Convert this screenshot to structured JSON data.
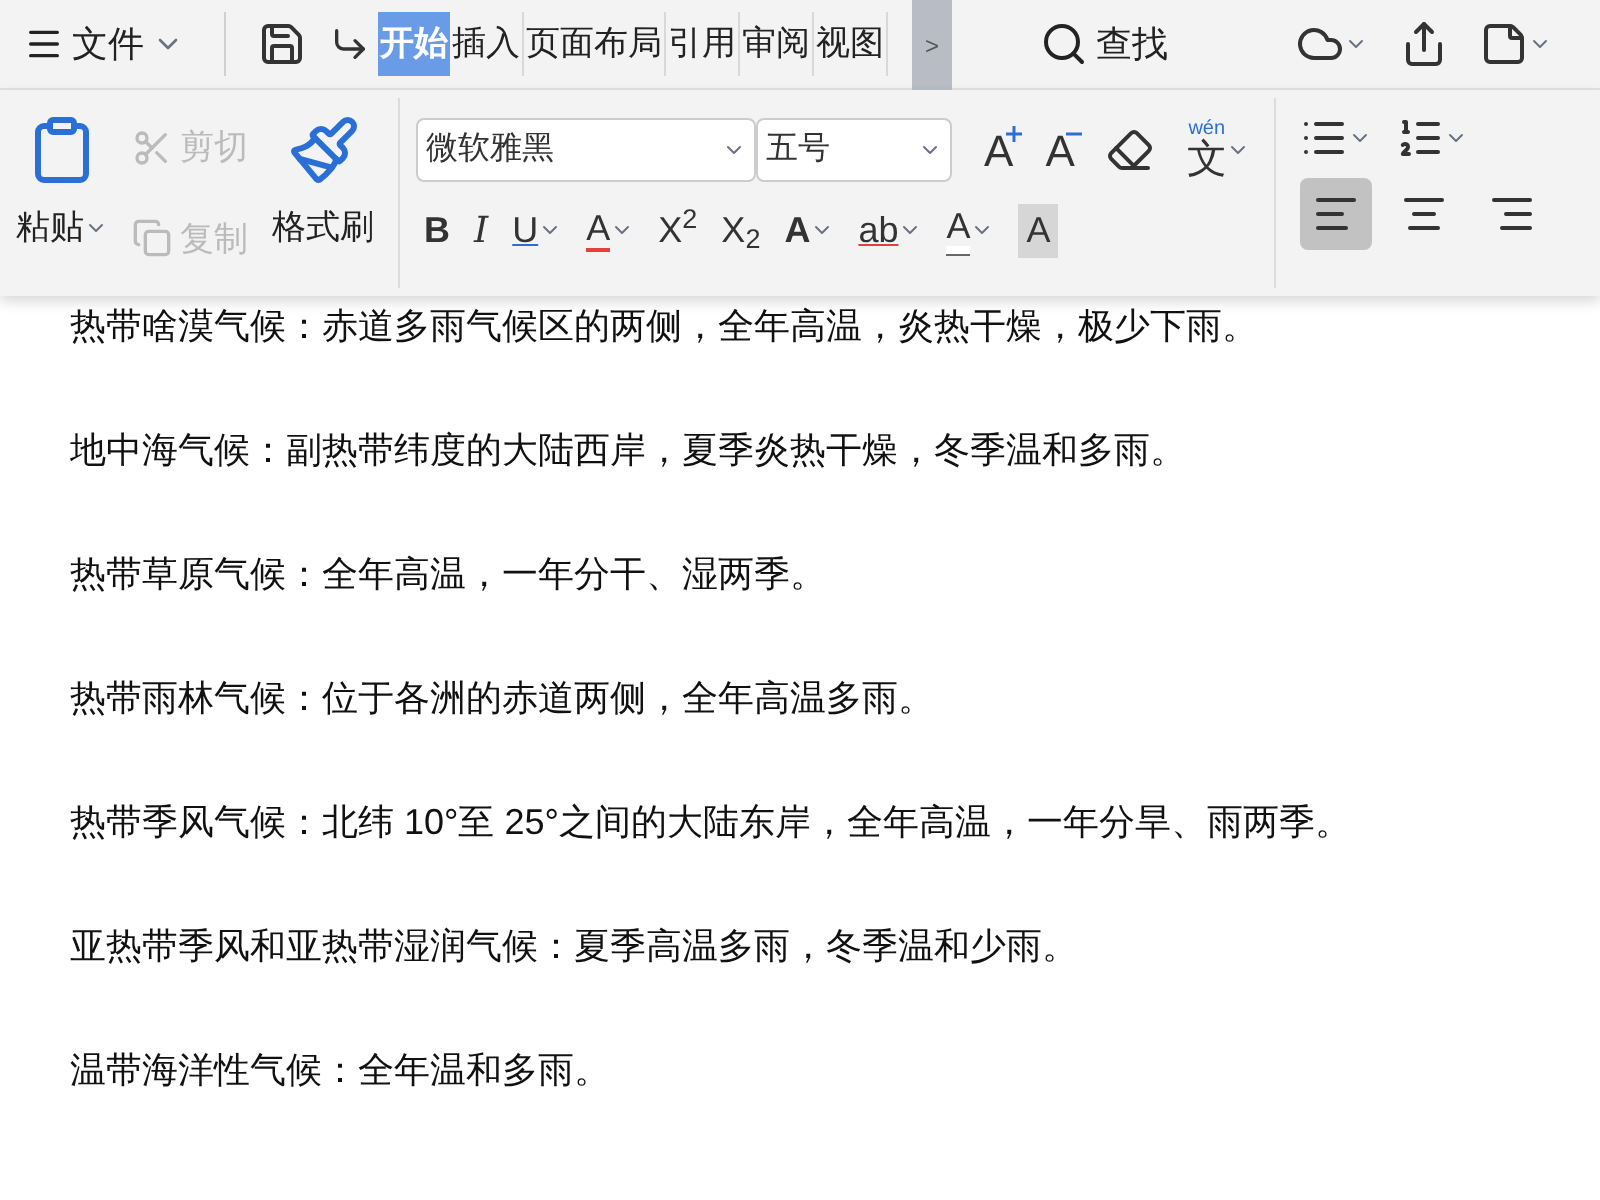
{
  "menu": {
    "label": "文件"
  },
  "tabs": [
    {
      "label": "开始",
      "selected": true
    },
    {
      "label": "插入",
      "selected": false
    },
    {
      "label": "页面布局",
      "selected": false
    },
    {
      "label": "引用",
      "selected": false
    },
    {
      "label": "审阅",
      "selected": false
    },
    {
      "label": "视图",
      "selected": false
    }
  ],
  "tab_scroll": ">",
  "search": {
    "label": "查找"
  },
  "clipboard": {
    "paste": "粘贴",
    "cut": {
      "label": "剪切",
      "disabled": true
    },
    "copy": {
      "label": "复制",
      "disabled": true
    },
    "format_painter": "格式刷"
  },
  "font": {
    "family": "微软雅黑",
    "size": "五号"
  },
  "font_row": [
    {
      "kind": "grow",
      "text": "A"
    },
    {
      "kind": "shrink",
      "text": "A"
    },
    {
      "kind": "eraser"
    },
    {
      "kind": "pinyin",
      "text": "文",
      "ruby": "wén",
      "dropdown": true
    }
  ],
  "format_row": [
    {
      "kind": "bold",
      "text": "B",
      "dropdown": false
    },
    {
      "kind": "italic",
      "text": "I",
      "dropdown": false
    },
    {
      "kind": "underline",
      "text": "U",
      "dropdown": true
    },
    {
      "kind": "strike",
      "text": "A",
      "dropdown": true
    },
    {
      "kind": "plain",
      "text": "X$^{2}$",
      "dropdown": false
    },
    {
      "kind": "plain",
      "text": "X$_{2}$",
      "dropdown": false
    },
    {
      "kind": "outline",
      "text": "A",
      "dropdown": true
    },
    {
      "kind": "highlight",
      "text": "ab",
      "dropdown": true
    },
    {
      "kind": "color",
      "text": "A",
      "dropdown": true
    },
    {
      "kind": "shade",
      "text": "A",
      "dropdown": false
    }
  ],
  "alignment": [
    {
      "kind": "left",
      "selected": true
    },
    {
      "kind": "center",
      "selected": false
    },
    {
      "kind": "right",
      "selected": false
    }
  ],
  "paragraphs": [
    "热带啥漠气候：赤道多雨气候区的两侧，全年高温，炎热干燥，极少下雨。",
    "地中海气候：副热带纬度的大陆西岸，夏季炎热干燥，冬季温和多雨。",
    "热带草原气候：全年高温，一年分干、湿两季。",
    "热带雨林气候：位于各洲的赤道两侧，全年高温多雨。",
    "热带季风气候：北纬 10°至 25°之间的大陆东岸，全年高温，一年分旱、雨两季。",
    "亚热带季风和亚热带湿润气候：夏季高温多雨，冬季温和少雨。",
    "温带海洋性气候：全年温和多雨。"
  ]
}
